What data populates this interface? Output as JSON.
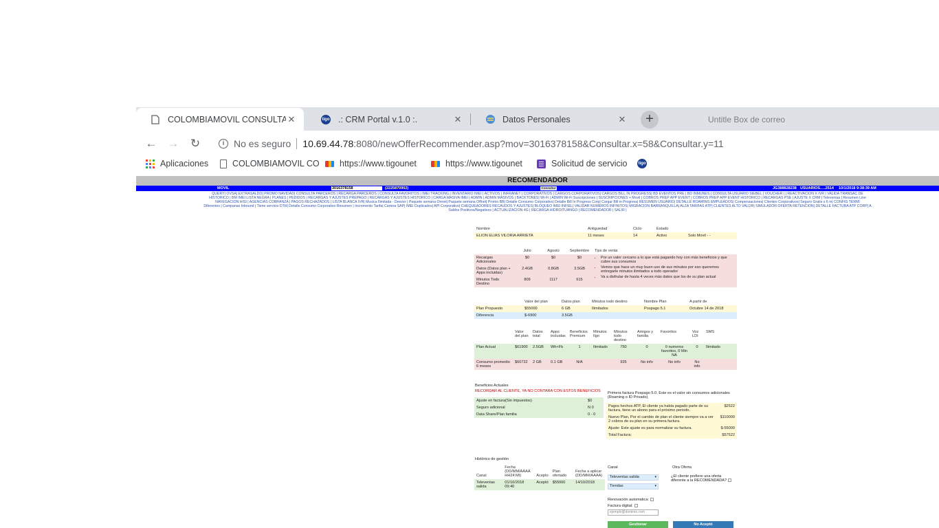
{
  "browser": {
    "tabs": [
      {
        "title": "COLOMBIAMOVIL CONSULTA IN",
        "active": true,
        "icon": "page-icon"
      },
      {
        "title": ".: CRM Portal v.1.0 :.",
        "active": false,
        "icon": "tigo-icon"
      },
      {
        "title": "Datos Personales",
        "active": false,
        "icon": "globe-icon"
      }
    ],
    "ghost_text": "Untitle Box de correo",
    "security_label": "No es seguro",
    "url_host": "10.69.44.78",
    "url_rest": ":8080/newOfferRecommender.asp?mov=3016378158&Consultar.x=58&Consultar.y=11",
    "bookmarks": [
      {
        "label": "Aplicaciones",
        "icon": "apps-icon"
      },
      {
        "label": "COLOMBIAMOVIL CO",
        "icon": "page-icon"
      },
      {
        "label": "https://www.tigounet",
        "icon": "tigo-une-icon"
      },
      {
        "label": "https://www.tigounet",
        "icon": "tigo-une-icon"
      },
      {
        "label": "Solicitud de servicio",
        "icon": "forms-icon"
      }
    ]
  },
  "page": {
    "title": "RECOMENDADOR",
    "bar": {
      "movil_label": "MOVIL",
      "phone_value": "3016378158",
      "account_value": "(2225870902)",
      "consultar_label": "Consultar",
      "user_info": "JG388828238",
      "users_label": "USUARIOS.....2514",
      "datetime": "10/1/2018 9:38:39 AM"
    },
    "menu_lines": [
      "QUERY| OVSA| EXTRASALDO| PROMO NAVIDAD| CONSULTA PARCEROS | RECARGA PARCEROS | CONSULTA FAVORITOS | IMEI TRACKING | INVENTARIO IMEI | ACTIVOS | INFRANET | CORPORATIVOS | CARGOS CORPORATIVOS| CARGOS BILL IN PROGRESS| BD EVENTOS PRE | BD INMUNES | CONSULTA USUARIO SIEBEL | VOUCHER | | REACTIVACION X IVR | VALIDA TRANSAC DE",
      "HISTORICO | BM IMEI LISTA NEGRA | PLANES | PEDIDOS | RECARGAS Y AJUSTES PREPAGO | RECARGAS Y AJUSTES HISTORICO | CARGA MASIVA IMEI | ADMIN | ADMIN MASIVOS | BACKTONES| Wi-Fi | ADMIN Wi-Fi Suscripciones | SUSCRIPCIONES + Movil | COBROS PREP APP EVENT | COBROS PREP APP EVENT HISTORICO | RECARGAS PSE | AJUSTE X CRM | Televentas | Resumen Line",
      "NAVEGACION HISI | AGENCIAS COBRANZA | PAGOS RECHAZADOS | LISTA BLANCA IVR| Musica Ilimitada - Deezer | Paquete semana Onnet| Paquete semana Offnet| Promo BB| Detalle Consumo Corporativo| Detalle Bill In Progress Corp| Cargar Bill in Progress| RESUMEN USUARIO| DETALLE ROAMING EMPLEADOS| Compensaciones| Clientes Corporativos| Seguro Gratis x 6 m| CONFIG TERMI",
      "Diferentes | Campanas Inbound | Tiene servicio DTH| Detalle Consumo Corporativo Resumen | Incremento Tarifa| Cartera SAP| IMEI Duplicados| API Corporativo| CHEQUEADORES RECAUDOS Y AJUSTES| BLOQUEO IMEI INFIEL| VALIDAR NUMEROS INFINITOS| MIGRACION BARRANQUILLA| ALZA TARIFAS ATP| CLIENTES ALTO VALOR| SIMULADOR OFERTA RETENCION| DETALLE FACTURA ATP CORP| A",
      "Saldos Positivos/Negativos | ACTUALIZACION 4G | RECARGA HIDROITUANGO | RECOMENDADOR | SALIR |"
    ],
    "customer": {
      "headers": [
        "Nombre",
        "Antiguedad",
        "Ciclo",
        "Estado",
        ""
      ],
      "values": [
        "ELION ELIAS VILORIA ARRIETA",
        "11 meses",
        "14",
        "Activo",
        "Solo Movil - -"
      ]
    },
    "usage": {
      "months": [
        "Julio",
        "Agosto",
        "Septiembre"
      ],
      "tips_title": "Tips de venta",
      "rows": [
        {
          "label": "Recargas Adicionales",
          "values": [
            "$0",
            "$0",
            "$0"
          ]
        },
        {
          "label": "Datos (Datos plan + Apps incluidas)",
          "values": [
            "2.4GB",
            "0.8GB",
            "3.5GB"
          ]
        },
        {
          "label": "Minutos Todo Destino",
          "values": [
            "809",
            "1117",
            "615"
          ]
        }
      ],
      "tips": [
        "Por un valor cercano a lo que está pagando hoy con más beneficios y que cubre sus consumos",
        "Vemos que hace un muy buen uso de sus minutos por eso queremos entregarle minutos ilimitados a todo operador",
        "Va a disfrutar de hasta 4 veces más datos que los de su plan actual"
      ]
    },
    "proposal": {
      "headers": [
        "",
        "Valor del plan",
        "Datos plan",
        "Minutos todo destino",
        "Nombre Plan",
        "A partir de"
      ],
      "rows": [
        [
          "Plan Propuesto",
          "$55000",
          "6 GB",
          "Ilimitados",
          "Pospago 5.1",
          "Octubre 14 de 2018"
        ],
        [
          "Diferencia",
          "$-6900",
          "3.5GB",
          "",
          "",
          ""
        ]
      ]
    },
    "comparison": {
      "headers": [
        "",
        "Valor del plan",
        "Datos total",
        "Apps incluidas",
        "Beneficios Premium",
        "Minutos Ilgo",
        "Minutos todo destino",
        "Amigos y familia",
        "Favoritos",
        "Voz LDI",
        "SMS"
      ],
      "rows": [
        [
          "Plan Actual",
          "$61900",
          "2.5GB",
          "Wh+Fb",
          "1",
          "Ilimitado",
          "750",
          "0",
          "0 numeros favoritos, 0 Min NA",
          "0",
          "Ilimitado"
        ],
        [
          "Consumo promedio 6 meses",
          "$60722",
          "2 GB",
          "0.1 GB",
          "N/A",
          "",
          "925",
          "No info",
          "No info",
          "No info",
          ""
        ]
      ]
    },
    "benefits": {
      "title": "Beneficios Actuales",
      "warning": "RECORDAR AL CLIENTE, YA NO CONTARA CON ESTOS BENEFICIOS",
      "rows": [
        [
          "Ajuste en factura(Sin impuestos)",
          "$0"
        ],
        [
          "Seguro adicional",
          "N 0"
        ],
        [
          "Data Share/Plan familia",
          "0 - 0"
        ]
      ]
    },
    "invoice": {
      "note": "Primera factura Pospago 5.0. Este es el valor sin consumos adicionales (Roaming o ID Privado)",
      "rows": [
        [
          "Pagos hechos ATP, El cliente ya había pagado parte de su factura, tiene un abono para el próximo periodo.",
          "$2522"
        ],
        [
          "Nuevo Plan, Por el cambio de plan el cliente siempre va a ver 2 cobros de su plan en su primera factura.",
          "$110000"
        ],
        [
          "Ajuste: Este ajuste es para normalizar su factura.",
          "$-55000"
        ],
        [
          "Total Factura:",
          "$57522"
        ]
      ]
    },
    "history": {
      "title": "Histórico de gestión",
      "headers": [
        "Canal",
        "Fecha (DD/MM/AAAA HH24:MI)",
        "Acepto",
        "Plan ofertado",
        "Fecha a aplicar (DD/MM/AAAA)"
      ],
      "rows": [
        [
          "Televentas salida",
          "01/10/2018 09:40",
          "Aceptó",
          "$55000",
          "14/10/2018"
        ]
      ]
    },
    "management": {
      "canal_label": "Canal",
      "otra_oferta_label": "Otra Oferta",
      "canal_options": [
        "Televentas salida",
        "Tiendas"
      ],
      "question": "¿El cliente prefiere una oferta diferente a la RECOMENDADA?",
      "renovacion_label": "Renovación automatica:",
      "factura_label": "Factura digital:",
      "email_placeholder": "ejemplo@dominio.com",
      "gestionar_label": "Gestionar",
      "no_acepto_label": "No Aceptó"
    }
  }
}
